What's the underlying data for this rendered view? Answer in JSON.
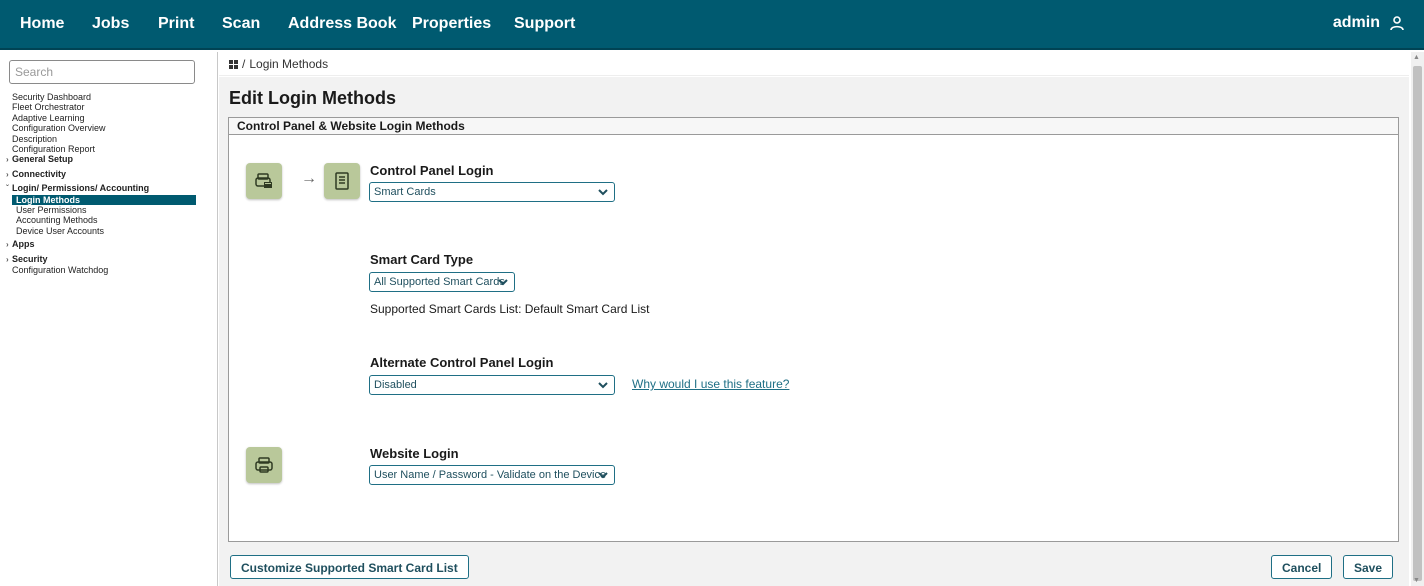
{
  "nav": {
    "items": [
      "Home",
      "Jobs",
      "Print",
      "Scan",
      "Address Book",
      "Properties",
      "Support"
    ],
    "user": "admin"
  },
  "sidebar": {
    "search_placeholder": "Search",
    "items": [
      {
        "label": "Security Dashboard"
      },
      {
        "label": "Fleet Orchestrator"
      },
      {
        "label": "Adaptive Learning"
      },
      {
        "label": "Configuration Overview"
      },
      {
        "label": "Description"
      },
      {
        "label": "Configuration Report"
      },
      {
        "label": "General Setup"
      },
      {
        "label": "Connectivity"
      },
      {
        "label": "Login/ Permissions/ Accounting"
      },
      {
        "label": "Login Methods"
      },
      {
        "label": "User Permissions"
      },
      {
        "label": "Accounting Methods"
      },
      {
        "label": "Device User Accounts"
      },
      {
        "label": "Apps"
      },
      {
        "label": "Security"
      },
      {
        "label": "Configuration Watchdog"
      }
    ]
  },
  "breadcrumb": {
    "sep": "/",
    "current": "Login Methods"
  },
  "page": {
    "title": "Edit Login Methods",
    "panel_title": "Control Panel & Website Login Methods"
  },
  "form": {
    "control_panel_login": {
      "label": "Control Panel Login",
      "value": "Smart Cards"
    },
    "smart_card_type": {
      "label": "Smart Card Type",
      "value": "All Supported Smart Cards"
    },
    "supported_list_text": "Supported Smart Cards List: Default Smart Card List",
    "alternate_login": {
      "label": "Alternate Control Panel Login",
      "value": "Disabled",
      "help_link": "Why would I use this feature?"
    },
    "website_login": {
      "label": "Website Login",
      "value": "User Name / Password - Validate on the Device"
    }
  },
  "buttons": {
    "customize": "Customize Supported Smart Card List",
    "cancel": "Cancel",
    "save": "Save"
  },
  "colors": {
    "brand": "#005a70",
    "tile": "#b9c89a"
  }
}
